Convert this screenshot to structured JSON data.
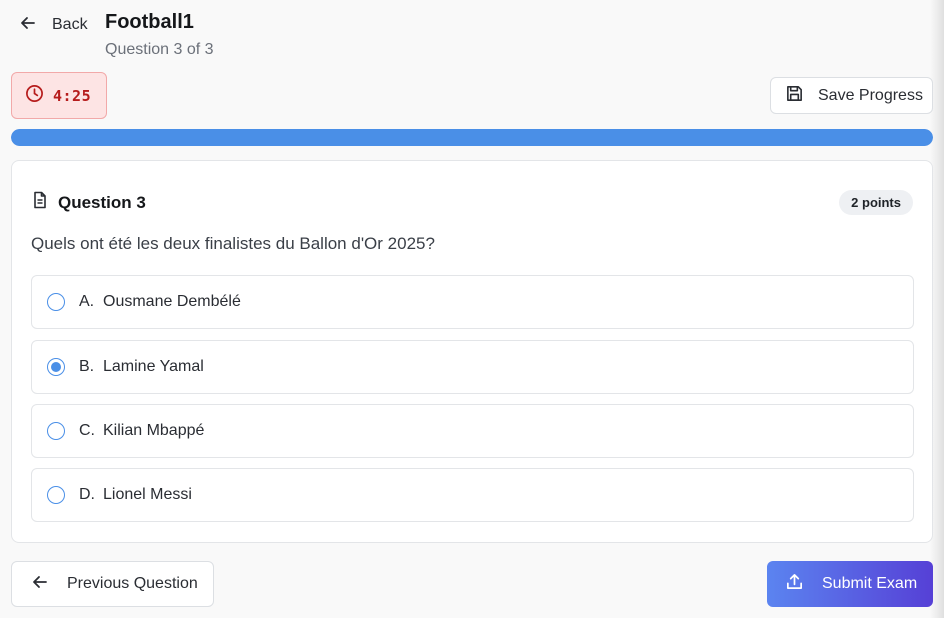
{
  "header": {
    "back_label": "Back",
    "title": "Football1",
    "subtitle": "Question 3 of 3"
  },
  "timer": {
    "value": "4:25",
    "icon": "clock-icon"
  },
  "save_label": "Save Progress",
  "progress": {
    "percent": 100
  },
  "question": {
    "label": "Question 3",
    "points": "2 points",
    "text": "Quels ont été les deux finalistes du Ballon d'Or 2025?",
    "options": [
      {
        "letter": "A.",
        "text": "Ousmane Dembélé",
        "selected": false
      },
      {
        "letter": "B.",
        "text": "Lamine Yamal",
        "selected": true
      },
      {
        "letter": "C.",
        "text": "Kilian Mbappé",
        "selected": false
      },
      {
        "letter": "D.",
        "text": "Lionel Messi",
        "selected": false
      }
    ]
  },
  "footer": {
    "prev_label": "Previous Question",
    "submit_label": "Submit Exam"
  },
  "colors": {
    "accent": "#4a8fe7",
    "timer_bg": "#fde4e4",
    "timer_text": "#b61c1c",
    "submit_gradient_start": "#5b84f0",
    "submit_gradient_end": "#5640d6"
  }
}
